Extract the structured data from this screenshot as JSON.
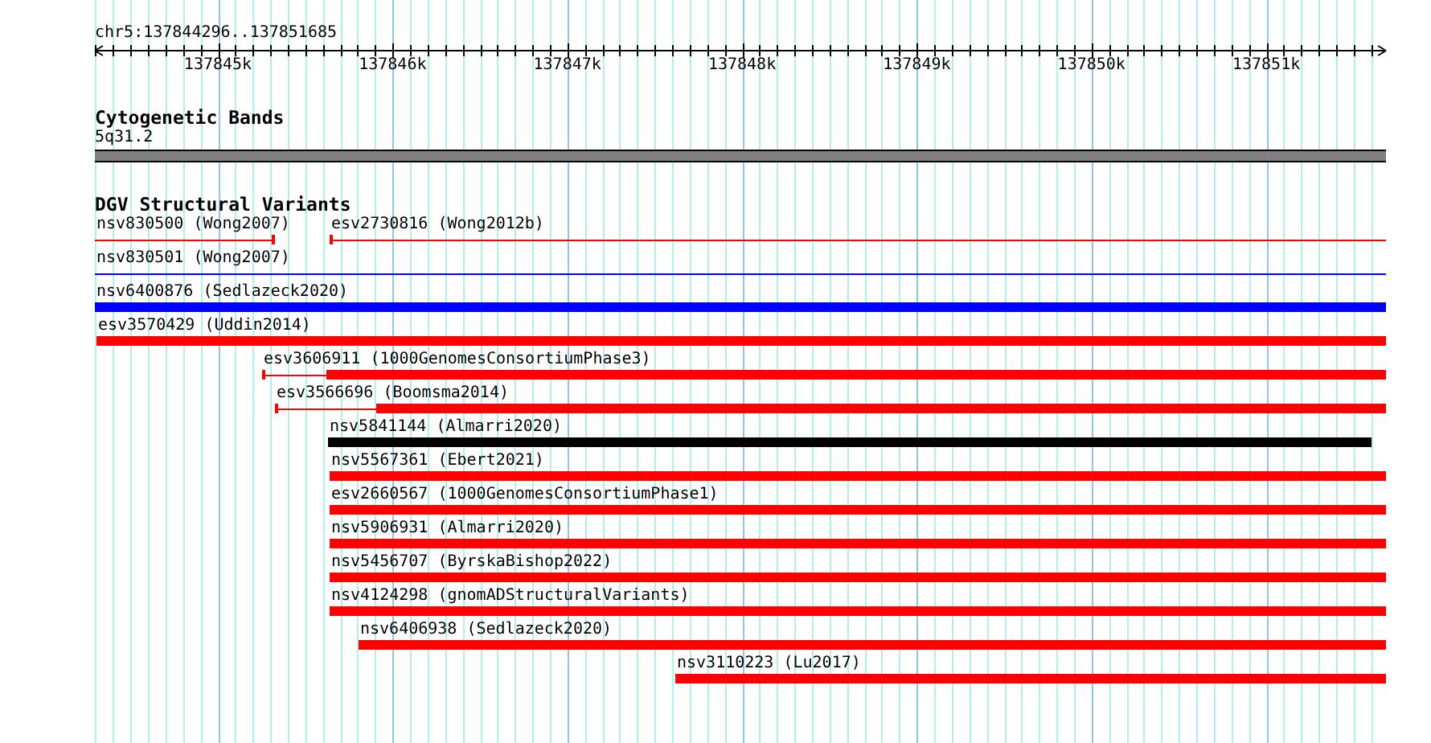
{
  "ruler": {
    "location": "chr5:137844296..137851685",
    "ticks": [
      "137845k",
      "137846k",
      "137847k",
      "137848k",
      "137849k",
      "137850k",
      "137851k"
    ]
  },
  "cytoband_track": {
    "title": "Cytogenetic Bands",
    "band": "5q31.2"
  },
  "variant_track": {
    "title": "DGV Structural Variants",
    "rows": [
      {
        "features": [
          {
            "label": "nsv830500 (Wong2007)",
            "kind": "thin",
            "color": "#ff0000"
          },
          {
            "label": "esv2730816 (Wong2012b)",
            "kind": "thin",
            "color": "#ff0000"
          }
        ]
      },
      {
        "features": [
          {
            "label": "nsv830501 (Wong2007)",
            "kind": "thin",
            "color": "#0000ff"
          }
        ]
      },
      {
        "features": [
          {
            "label": "nsv6400876 (Sedlazeck2020)",
            "kind": "thick",
            "color": "#0000ff"
          }
        ]
      },
      {
        "features": [
          {
            "label": "esv3570429 (Uddin2014)",
            "kind": "thick",
            "color": "#ff0000"
          }
        ]
      },
      {
        "features": [
          {
            "label": "esv3606911 (1000GenomesConsortiumPhase3)",
            "kind": "mixed",
            "color": "#ff0000"
          }
        ]
      },
      {
        "features": [
          {
            "label": "esv3566696 (Boomsma2014)",
            "kind": "mixed",
            "color": "#ff0000"
          }
        ]
      },
      {
        "features": [
          {
            "label": "nsv5841144 (Almarri2020)",
            "kind": "thick",
            "color": "#000000"
          }
        ]
      },
      {
        "features": [
          {
            "label": "nsv5567361 (Ebert2021)",
            "kind": "thick",
            "color": "#ff0000"
          }
        ]
      },
      {
        "features": [
          {
            "label": "esv2660567 (1000GenomesConsortiumPhase1)",
            "kind": "thick",
            "color": "#ff0000"
          }
        ]
      },
      {
        "features": [
          {
            "label": "nsv5906931 (Almarri2020)",
            "kind": "thick",
            "color": "#ff0000"
          }
        ]
      },
      {
        "features": [
          {
            "label": "nsv5456707 (ByrskaBishop2022)",
            "kind": "thick",
            "color": "#ff0000"
          }
        ]
      },
      {
        "features": [
          {
            "label": "nsv4124298 (gnomADStructuralVariants)",
            "kind": "thick",
            "color": "#ff0000"
          }
        ]
      },
      {
        "features": [
          {
            "label": "nsv6406938 (Sedlazeck2020)",
            "kind": "thick",
            "color": "#ff0000"
          }
        ]
      },
      {
        "features": [
          {
            "label": "nsv3110223 (Lu2017)",
            "kind": "thick",
            "color": "#ff0000"
          }
        ]
      }
    ]
  }
}
